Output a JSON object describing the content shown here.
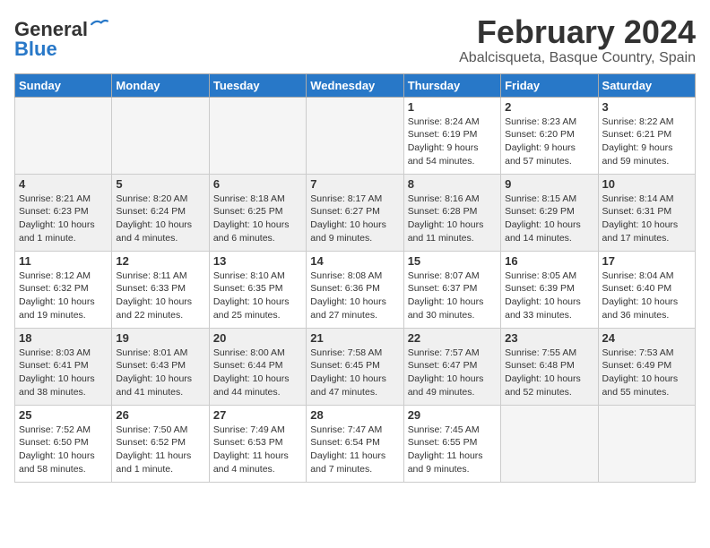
{
  "header": {
    "logo_line1": "General",
    "logo_line2": "Blue",
    "month_year": "February 2024",
    "location": "Abalcisqueta, Basque Country, Spain"
  },
  "weekdays": [
    "Sunday",
    "Monday",
    "Tuesday",
    "Wednesday",
    "Thursday",
    "Friday",
    "Saturday"
  ],
  "weeks": [
    [
      {
        "day": "",
        "info": ""
      },
      {
        "day": "",
        "info": ""
      },
      {
        "day": "",
        "info": ""
      },
      {
        "day": "",
        "info": ""
      },
      {
        "day": "1",
        "info": "Sunrise: 8:24 AM\nSunset: 6:19 PM\nDaylight: 9 hours\nand 54 minutes."
      },
      {
        "day": "2",
        "info": "Sunrise: 8:23 AM\nSunset: 6:20 PM\nDaylight: 9 hours\nand 57 minutes."
      },
      {
        "day": "3",
        "info": "Sunrise: 8:22 AM\nSunset: 6:21 PM\nDaylight: 9 hours\nand 59 minutes."
      }
    ],
    [
      {
        "day": "4",
        "info": "Sunrise: 8:21 AM\nSunset: 6:23 PM\nDaylight: 10 hours\nand 1 minute."
      },
      {
        "day": "5",
        "info": "Sunrise: 8:20 AM\nSunset: 6:24 PM\nDaylight: 10 hours\nand 4 minutes."
      },
      {
        "day": "6",
        "info": "Sunrise: 8:18 AM\nSunset: 6:25 PM\nDaylight: 10 hours\nand 6 minutes."
      },
      {
        "day": "7",
        "info": "Sunrise: 8:17 AM\nSunset: 6:27 PM\nDaylight: 10 hours\nand 9 minutes."
      },
      {
        "day": "8",
        "info": "Sunrise: 8:16 AM\nSunset: 6:28 PM\nDaylight: 10 hours\nand 11 minutes."
      },
      {
        "day": "9",
        "info": "Sunrise: 8:15 AM\nSunset: 6:29 PM\nDaylight: 10 hours\nand 14 minutes."
      },
      {
        "day": "10",
        "info": "Sunrise: 8:14 AM\nSunset: 6:31 PM\nDaylight: 10 hours\nand 17 minutes."
      }
    ],
    [
      {
        "day": "11",
        "info": "Sunrise: 8:12 AM\nSunset: 6:32 PM\nDaylight: 10 hours\nand 19 minutes."
      },
      {
        "day": "12",
        "info": "Sunrise: 8:11 AM\nSunset: 6:33 PM\nDaylight: 10 hours\nand 22 minutes."
      },
      {
        "day": "13",
        "info": "Sunrise: 8:10 AM\nSunset: 6:35 PM\nDaylight: 10 hours\nand 25 minutes."
      },
      {
        "day": "14",
        "info": "Sunrise: 8:08 AM\nSunset: 6:36 PM\nDaylight: 10 hours\nand 27 minutes."
      },
      {
        "day": "15",
        "info": "Sunrise: 8:07 AM\nSunset: 6:37 PM\nDaylight: 10 hours\nand 30 minutes."
      },
      {
        "day": "16",
        "info": "Sunrise: 8:05 AM\nSunset: 6:39 PM\nDaylight: 10 hours\nand 33 minutes."
      },
      {
        "day": "17",
        "info": "Sunrise: 8:04 AM\nSunset: 6:40 PM\nDaylight: 10 hours\nand 36 minutes."
      }
    ],
    [
      {
        "day": "18",
        "info": "Sunrise: 8:03 AM\nSunset: 6:41 PM\nDaylight: 10 hours\nand 38 minutes."
      },
      {
        "day": "19",
        "info": "Sunrise: 8:01 AM\nSunset: 6:43 PM\nDaylight: 10 hours\nand 41 minutes."
      },
      {
        "day": "20",
        "info": "Sunrise: 8:00 AM\nSunset: 6:44 PM\nDaylight: 10 hours\nand 44 minutes."
      },
      {
        "day": "21",
        "info": "Sunrise: 7:58 AM\nSunset: 6:45 PM\nDaylight: 10 hours\nand 47 minutes."
      },
      {
        "day": "22",
        "info": "Sunrise: 7:57 AM\nSunset: 6:47 PM\nDaylight: 10 hours\nand 49 minutes."
      },
      {
        "day": "23",
        "info": "Sunrise: 7:55 AM\nSunset: 6:48 PM\nDaylight: 10 hours\nand 52 minutes."
      },
      {
        "day": "24",
        "info": "Sunrise: 7:53 AM\nSunset: 6:49 PM\nDaylight: 10 hours\nand 55 minutes."
      }
    ],
    [
      {
        "day": "25",
        "info": "Sunrise: 7:52 AM\nSunset: 6:50 PM\nDaylight: 10 hours\nand 58 minutes."
      },
      {
        "day": "26",
        "info": "Sunrise: 7:50 AM\nSunset: 6:52 PM\nDaylight: 11 hours\nand 1 minute."
      },
      {
        "day": "27",
        "info": "Sunrise: 7:49 AM\nSunset: 6:53 PM\nDaylight: 11 hours\nand 4 minutes."
      },
      {
        "day": "28",
        "info": "Sunrise: 7:47 AM\nSunset: 6:54 PM\nDaylight: 11 hours\nand 7 minutes."
      },
      {
        "day": "29",
        "info": "Sunrise: 7:45 AM\nSunset: 6:55 PM\nDaylight: 11 hours\nand 9 minutes."
      },
      {
        "day": "",
        "info": ""
      },
      {
        "day": "",
        "info": ""
      }
    ]
  ]
}
